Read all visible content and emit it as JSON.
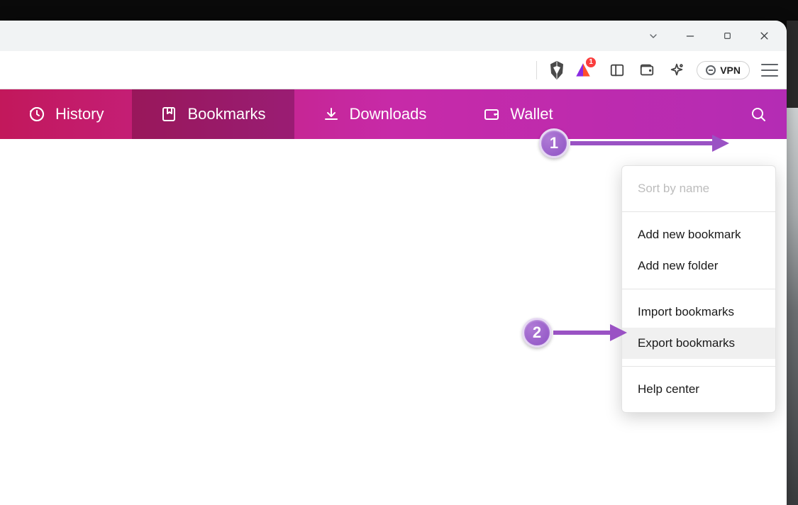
{
  "window": {
    "chevron": "⌄"
  },
  "toolbar": {
    "reward_badge": "1",
    "vpn_label": "VPN"
  },
  "nav": {
    "items": [
      {
        "label": "History"
      },
      {
        "label": "Bookmarks"
      },
      {
        "label": "Downloads"
      },
      {
        "label": "Wallet"
      }
    ]
  },
  "dropdown": {
    "sort": "Sort by name",
    "add_bookmark": "Add new bookmark",
    "add_folder": "Add new folder",
    "import": "Import bookmarks",
    "export": "Export bookmarks",
    "help": "Help center"
  },
  "annotations": {
    "step1": "1",
    "step2": "2"
  }
}
